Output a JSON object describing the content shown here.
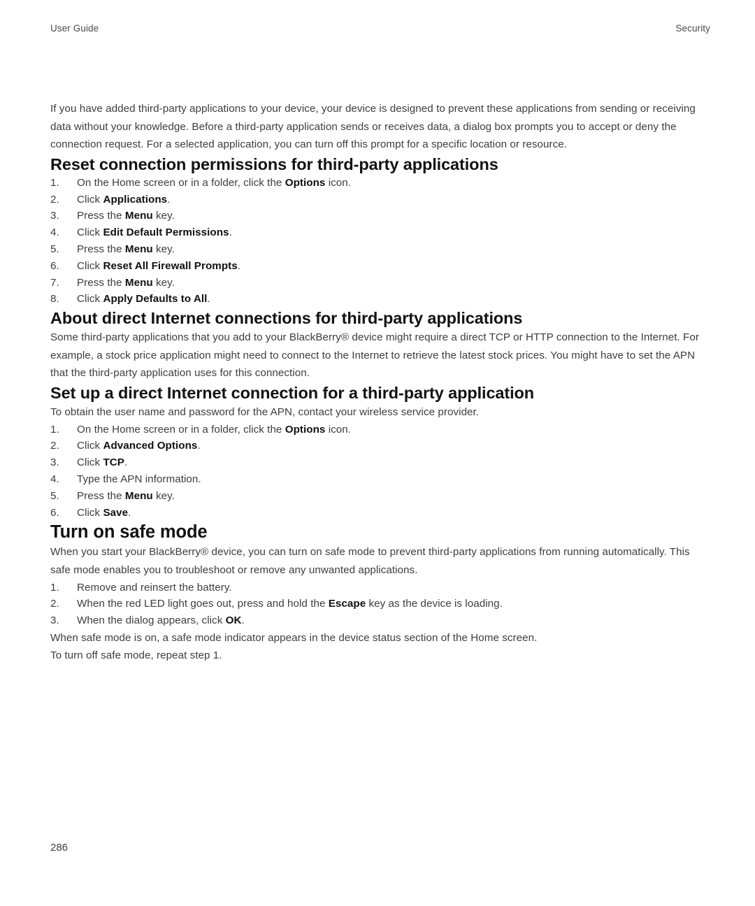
{
  "header": {
    "left": "User Guide",
    "right": "Security"
  },
  "intro": {
    "paragraph": "If you have added third-party applications to your device, your device is designed to prevent these applications from sending or receiving data without your knowledge. Before a third-party application sends or receives data, a dialog box prompts you to accept or deny the connection request. For a selected application, you can turn off this prompt for a specific location or resource."
  },
  "sections": [
    {
      "id": "reset-connection-permissions",
      "heading": "Reset connection permissions for third-party applications",
      "level": 2,
      "steps": [
        {
          "num": "1.",
          "pre": "On the Home screen or in a folder, click the ",
          "bold": "Options",
          "post": " icon."
        },
        {
          "num": "2.",
          "pre": "Click ",
          "bold": "Applications",
          "post": "."
        },
        {
          "num": "3.",
          "pre": "Press the ",
          "bold": "Menu",
          "post": " key."
        },
        {
          "num": "4.",
          "pre": "Click ",
          "bold": "Edit Default Permissions",
          "post": "."
        },
        {
          "num": "5.",
          "pre": "Press the ",
          "bold": "Menu",
          "post": " key."
        },
        {
          "num": "6.",
          "pre": "Click ",
          "bold": "Reset All Firewall Prompts",
          "post": "."
        },
        {
          "num": "7.",
          "pre": "Press the ",
          "bold": "Menu",
          "post": " key."
        },
        {
          "num": "8.",
          "pre": "Click ",
          "bold": "Apply Defaults to All",
          "post": "."
        }
      ]
    },
    {
      "id": "about-direct-internet-connections",
      "heading": "About direct Internet connections for third-party applications",
      "level": 2,
      "paragraph": "Some third-party applications that you add to your BlackBerry® device might require a direct TCP or HTTP connection to the Internet. For example, a stock price application might need to connect to the Internet to retrieve the latest stock prices. You might have to set the APN that the third-party application uses for this connection."
    },
    {
      "id": "set-up-direct-internet-connection",
      "heading": "Set up a direct Internet connection for a third-party application",
      "level": 2,
      "lead": "To obtain the user name and password for the APN, contact your wireless service provider.",
      "steps": [
        {
          "num": "1.",
          "pre": "On the Home screen or in a folder, click the ",
          "bold": "Options",
          "post": " icon."
        },
        {
          "num": "2.",
          "pre": "Click ",
          "bold": "Advanced Options",
          "post": "."
        },
        {
          "num": "3.",
          "pre": "Click ",
          "bold": "TCP",
          "post": "."
        },
        {
          "num": "4.",
          "pre": "Type the APN information.",
          "bold": "",
          "post": ""
        },
        {
          "num": "5.",
          "pre": "Press the ",
          "bold": "Menu",
          "post": " key."
        },
        {
          "num": "6.",
          "pre": "Click ",
          "bold": "Save",
          "post": "."
        }
      ]
    },
    {
      "id": "turn-on-safe-mode",
      "heading": "Turn on safe mode",
      "level": 1,
      "paragraph": "When you start your BlackBerry® device, you can turn on safe mode to prevent third-party applications from running automatically. This safe mode enables you to troubleshoot or remove any unwanted applications.",
      "steps": [
        {
          "num": "1.",
          "pre": "Remove and reinsert the battery.",
          "bold": "",
          "post": ""
        },
        {
          "num": "2.",
          "pre": "When the red LED light goes out, press and hold the ",
          "bold": "Escape",
          "post": " key as the device is loading."
        },
        {
          "num": "3.",
          "pre": "When the dialog appears, click ",
          "bold": "OK",
          "post": "."
        }
      ],
      "closing_paragraphs": [
        "When safe mode is on, a safe mode indicator appears in the device status section of the Home screen.",
        "To turn off safe mode, repeat step 1."
      ]
    }
  ],
  "folio": {
    "page_number": "286"
  }
}
